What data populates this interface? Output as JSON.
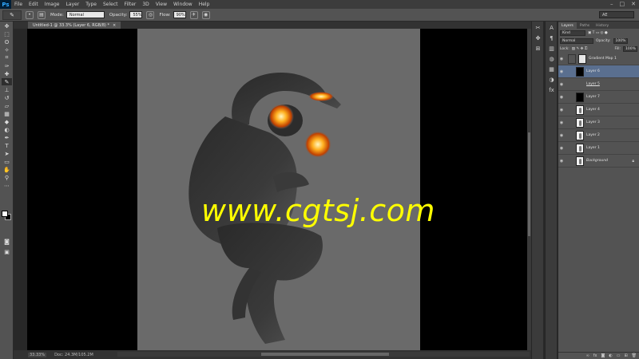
{
  "app": {
    "logo": "Ps"
  },
  "menu": [
    "File",
    "Edit",
    "Image",
    "Layer",
    "Type",
    "Select",
    "Filter",
    "3D",
    "View",
    "Window",
    "Help"
  ],
  "window_controls": [
    "–",
    "□",
    "✕"
  ],
  "options": {
    "mode_label": "Mode:",
    "mode_value": "Normal",
    "opacity_label": "Opacity:",
    "opacity_value": "55%",
    "flow_label": "Flow:",
    "flow_value": "90%",
    "workspace": "AE"
  },
  "document": {
    "tab_title": "Untitled-1 @ 33.3% (Layer 6, RGB/8) *",
    "close": "×",
    "zoom": "33.33%",
    "doc_info": "Doc: 24.3M/105.2M",
    "watermark": "www.cgtsj.com"
  },
  "layers_panel": {
    "tabs": [
      "Layers",
      "Paths",
      "History"
    ],
    "filter_kind": "Kind",
    "blend_mode": "Normal",
    "opacity_label": "Opacity:",
    "opacity_value": "100%",
    "lock_label": "Lock:",
    "fill_label": "Fill:",
    "fill_value": "100%",
    "layers": [
      {
        "name": "Gradient Map 1",
        "thumb": "white"
      },
      {
        "name": "Layer 6",
        "thumb": "black"
      },
      {
        "name": "Layer 5",
        "thumb": "none"
      },
      {
        "name": "Layer 7",
        "thumb": "black"
      },
      {
        "name": "Layer 4",
        "thumb": "figure"
      },
      {
        "name": "Layer 3",
        "thumb": "figure"
      },
      {
        "name": "Layer 2",
        "thumb": "figure"
      },
      {
        "name": "Layer 1",
        "thumb": "figure"
      },
      {
        "name": "Background",
        "thumb": "figure"
      }
    ]
  },
  "colors": {
    "watermark": "#ffff00",
    "selected_layer": "#5a6f8f",
    "ui_panel": "#535353",
    "canvas_bg": "#6a6a6a"
  }
}
